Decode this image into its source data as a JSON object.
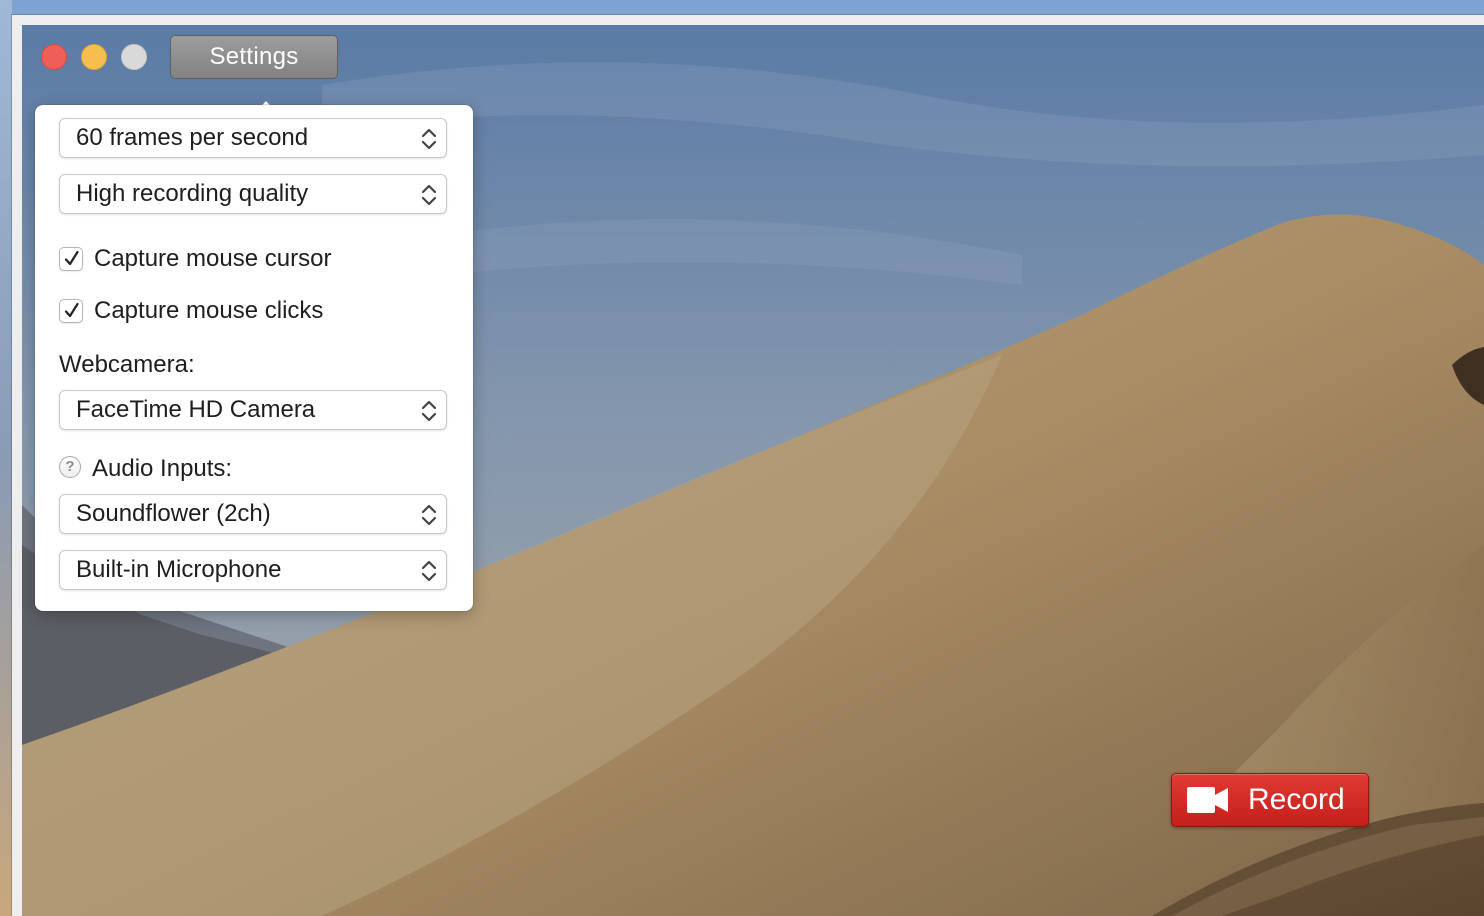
{
  "window": {
    "settings_label": "Settings"
  },
  "popover": {
    "fps_select": {
      "value": "60 frames per second"
    },
    "quality_select": {
      "value": "High recording quality"
    },
    "capture_cursor": {
      "label": "Capture mouse cursor",
      "checked": true
    },
    "capture_clicks": {
      "label": "Capture mouse clicks",
      "checked": true
    },
    "webcam_label": "Webcamera:",
    "webcam_select": {
      "value": "FaceTime HD Camera"
    },
    "audio_label": "Audio Inputs:",
    "audio_help_icon": "?",
    "audio_select_1": {
      "value": "Soundflower (2ch)"
    },
    "audio_select_2": {
      "value": "Built-in Microphone"
    }
  },
  "record_button": {
    "label": "Record",
    "icon": "video-camera-icon",
    "color": "#d12b26"
  },
  "colors": {
    "close": "#ee5f58",
    "minimize": "#f6be4f",
    "zoom": "#d9d9d9"
  }
}
